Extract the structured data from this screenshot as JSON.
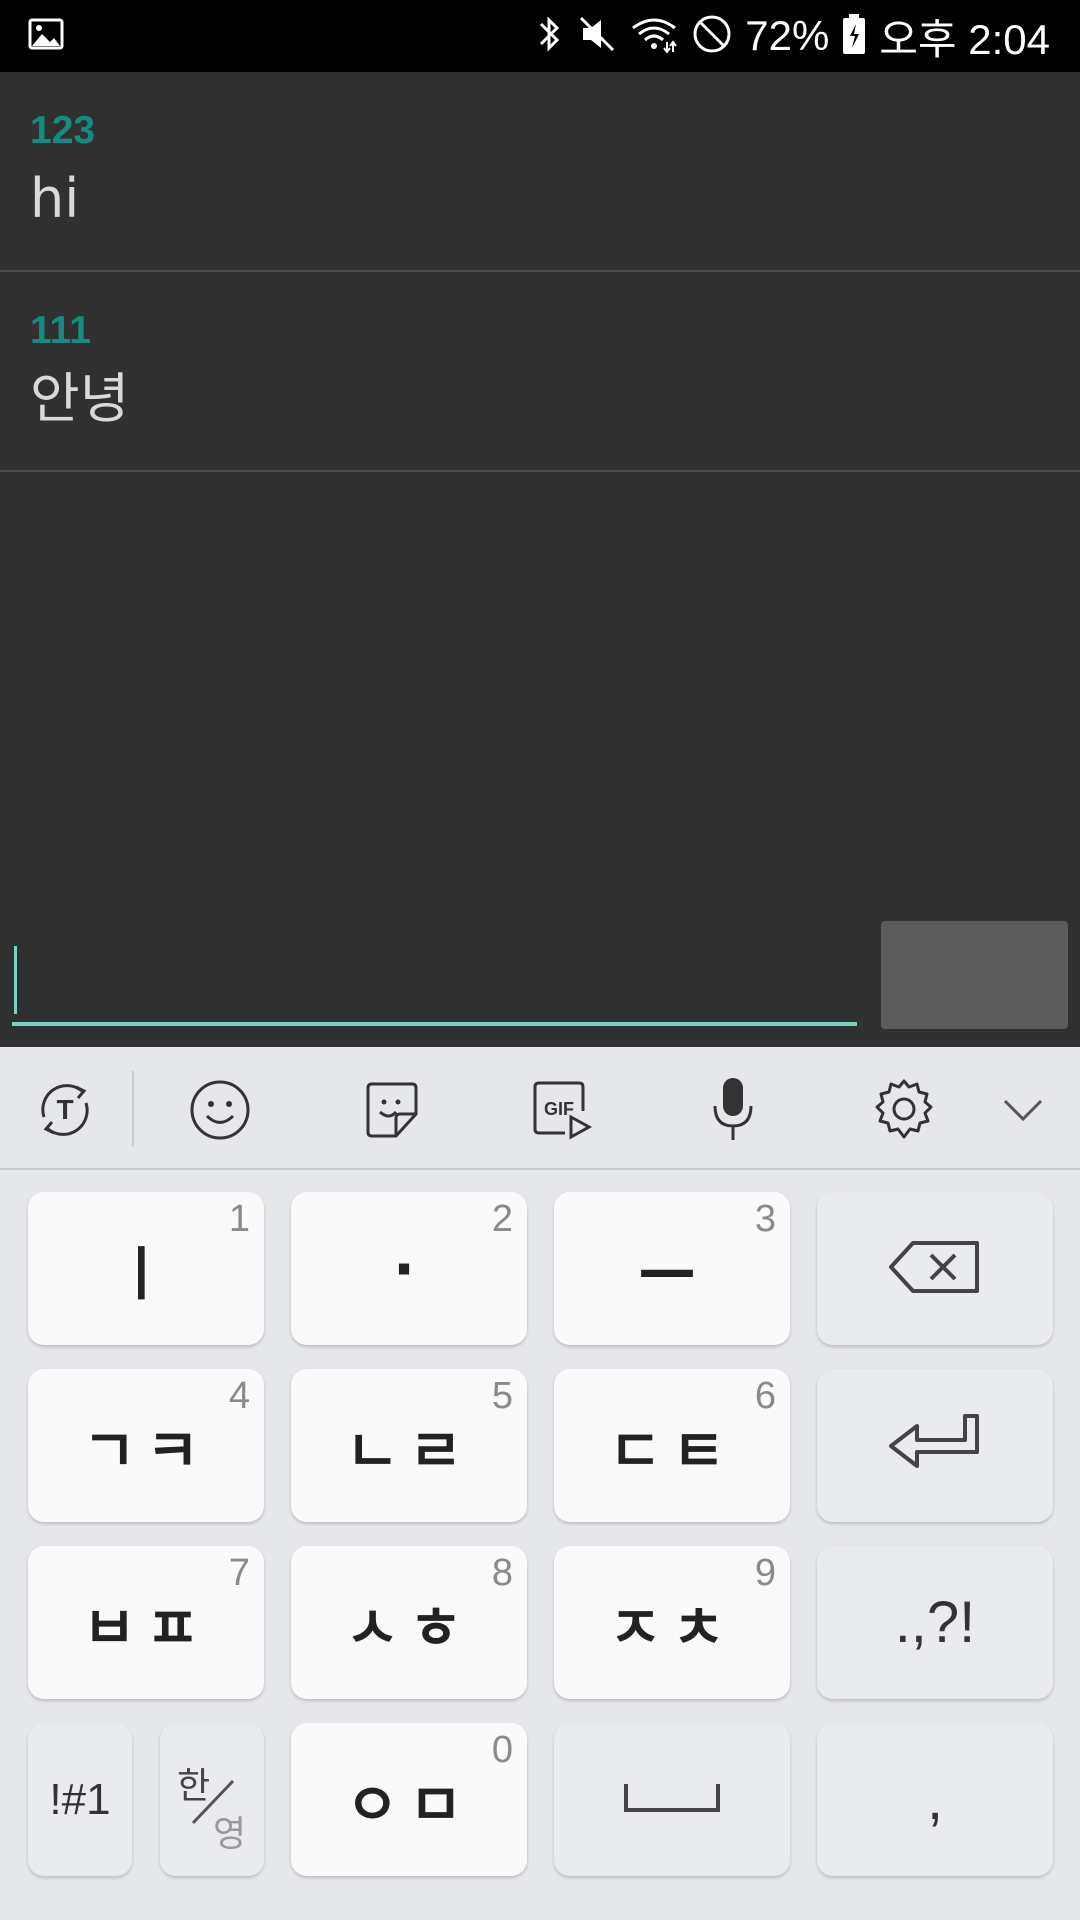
{
  "status_bar": {
    "left_icon": "gallery-icon",
    "icons": [
      "bluetooth-icon",
      "mute-icon",
      "wifi-icon",
      "do-not-disturb-icon"
    ],
    "battery_percent": "72%",
    "time": "오후 2:04"
  },
  "messages": [
    {
      "name": "123",
      "text": "hi"
    },
    {
      "name": "111",
      "text": "안녕"
    }
  ],
  "composer": {
    "value": "",
    "placeholder": "",
    "send_label": ""
  },
  "keyboard": {
    "toolbar": [
      "text-translate-icon",
      "emoji-icon",
      "sticker-icon",
      "gif-icon",
      "microphone-icon",
      "settings-icon",
      "collapse-chevron-icon"
    ],
    "rows": [
      [
        {
          "label": "ㅣ",
          "num": "1"
        },
        {
          "label": "·",
          "num": "2"
        },
        {
          "label": "—",
          "num": "3"
        },
        {
          "label": "",
          "icon": "backspace-icon"
        }
      ],
      [
        {
          "label": "ㄱㅋ",
          "num": "4"
        },
        {
          "label": "ㄴㄹ",
          "num": "5"
        },
        {
          "label": "ㄷㅌ",
          "num": "6"
        },
        {
          "label": "",
          "icon": "enter-icon"
        }
      ],
      [
        {
          "label": "ㅂㅍ",
          "num": "7"
        },
        {
          "label": "ㅅㅎ",
          "num": "8"
        },
        {
          "label": "ㅈㅊ",
          "num": "9"
        },
        {
          "label": ".,?!"
        }
      ],
      [
        {
          "label": "!#1"
        },
        {
          "label": "한/영",
          "top": "한",
          "bottom": "영"
        },
        {
          "label": "ㅇㅁ",
          "num": "0"
        },
        {
          "label": "",
          "icon": "space-icon"
        },
        {
          "label": ","
        }
      ]
    ]
  }
}
